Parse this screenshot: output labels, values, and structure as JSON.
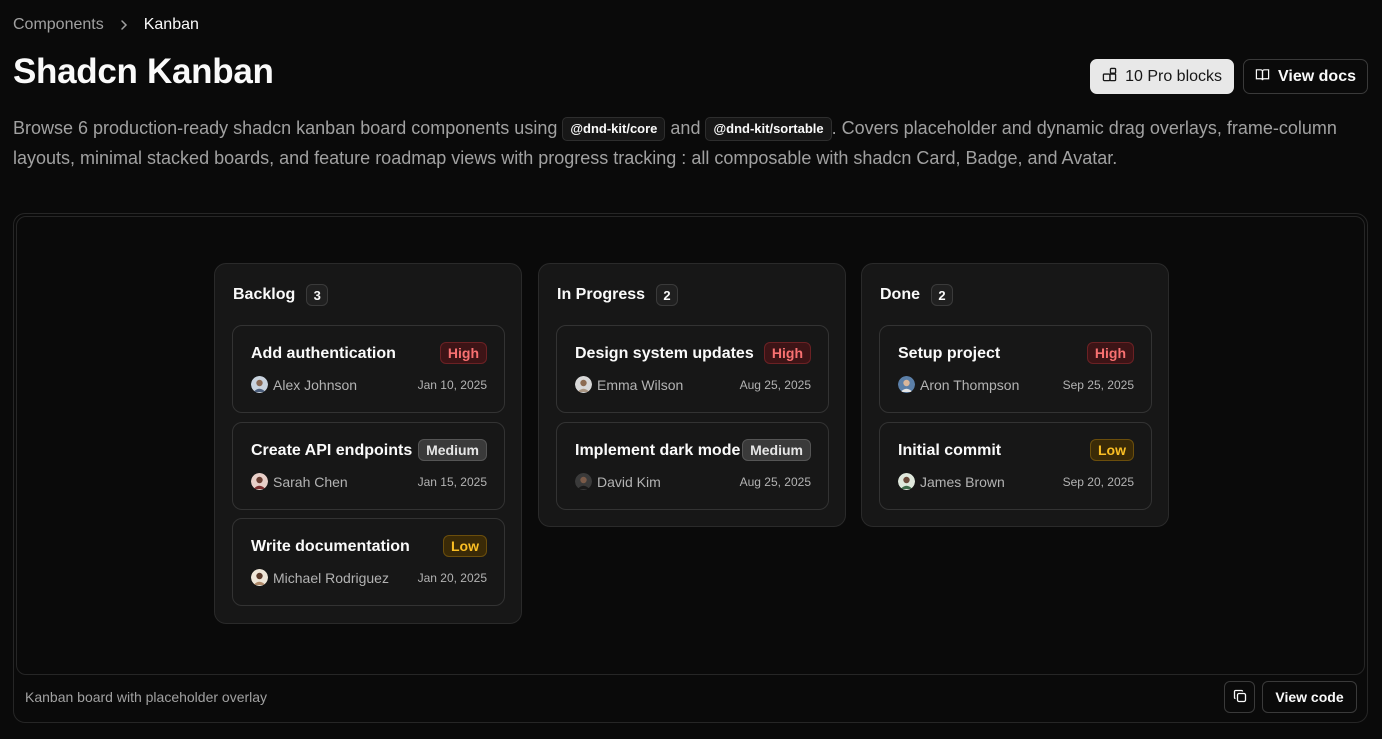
{
  "breadcrumb": {
    "parent": "Components",
    "current": "Kanban"
  },
  "page": {
    "title": "Shadcn Kanban"
  },
  "actions": {
    "pro_blocks": "10 Pro blocks",
    "view_docs": "View docs"
  },
  "description": {
    "part1": "Browse 6 production-ready shadcn kanban board components using ",
    "code1": "@dnd-kit/core",
    "part2": " and ",
    "code2": "@dnd-kit/sortable",
    "part3": ". Covers placeholder and dynamic drag overlays, frame-column layouts, minimal stacked boards, and feature roadmap views with progress tracking : all composable with shadcn Card, Badge, and Avatar."
  },
  "demo": {
    "caption": "Kanban board with placeholder overlay",
    "view_code": "View code",
    "columns": [
      {
        "title": "Backlog",
        "count": "3",
        "cards": [
          {
            "title": "Add authentication",
            "priority": "High",
            "assignee": "Alex Johnson",
            "date": "Jan 10, 2025"
          },
          {
            "title": "Create API endpoints",
            "priority": "Medium",
            "assignee": "Sarah Chen",
            "date": "Jan 15, 2025"
          },
          {
            "title": "Write documentation",
            "priority": "Low",
            "assignee": "Michael Rodriguez",
            "date": "Jan 20, 2025"
          }
        ]
      },
      {
        "title": "In Progress",
        "count": "2",
        "cards": [
          {
            "title": "Design system updates",
            "priority": "High",
            "assignee": "Emma Wilson",
            "date": "Aug 25, 2025"
          },
          {
            "title": "Implement dark mode",
            "priority": "Medium",
            "assignee": "David Kim",
            "date": "Aug 25, 2025"
          }
        ]
      },
      {
        "title": "Done",
        "count": "2",
        "cards": [
          {
            "title": "Setup project",
            "priority": "High",
            "assignee": "Aron Thompson",
            "date": "Sep 25, 2025"
          },
          {
            "title": "Initial commit",
            "priority": "Low",
            "assignee": "James Brown",
            "date": "Sep 20, 2025"
          }
        ]
      }
    ]
  },
  "colors": {
    "background": "#0a0a0a",
    "column": "#171717",
    "high": "#f87171",
    "medium": "#e5e5e5",
    "low": "#fbbf24"
  },
  "icons": {
    "breadcrumb_separator": "chevron-right-icon",
    "pro_blocks": "blocks-icon",
    "view_docs": "book-open-icon",
    "copy": "copy-icon"
  }
}
